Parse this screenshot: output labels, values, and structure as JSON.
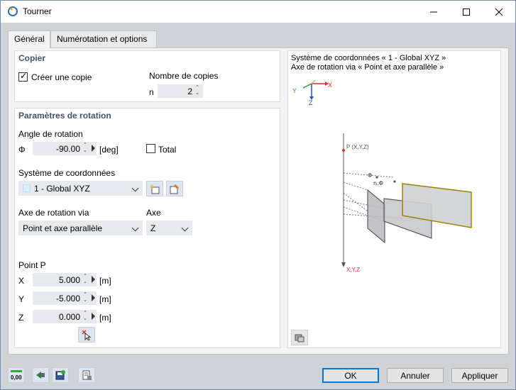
{
  "window": {
    "title": "Tourner",
    "app_icon": "rotate-tool-icon"
  },
  "tabs": [
    {
      "label": "Général",
      "active": true
    },
    {
      "label": "Numérotation et options",
      "active": false
    }
  ],
  "copy": {
    "title": "Copier",
    "create_copy_label": "Créer une copie",
    "create_copy_checked": true,
    "count_label": "Nombre de copies",
    "n_label": "n",
    "count_value": "2"
  },
  "rotation": {
    "title": "Paramètres de rotation",
    "angle_label": "Angle de rotation",
    "phi_label": "Φ",
    "angle_value": "-90.00",
    "angle_unit": "[deg]",
    "total_label": "Total",
    "total_checked": false,
    "coord_label": "Système de coordonnées",
    "coord_value": "1 - Global XYZ",
    "axis_via_label": "Axe de rotation via",
    "axis_via_value": "Point et axe parallèle",
    "axis_label": "Axe",
    "axis_value": "Z",
    "point_label": "Point P",
    "points": [
      {
        "label": "X",
        "value": "5.000",
        "unit": "[m]"
      },
      {
        "label": "Y",
        "value": "-5.000",
        "unit": "[m]"
      },
      {
        "label": "Z",
        "value": "0.000",
        "unit": "[m]"
      }
    ]
  },
  "preview": {
    "line1": "Système de coordonnées « 1 - Global XYZ »",
    "line2": "Axe de rotation via « Point et axe parallèle »",
    "axis_y": "Y",
    "axis_x": "X",
    "axis_z": "Z",
    "point_label": "P (X,Y,Z)",
    "phi_label": "Φ",
    "nphi_label": "n.Φ",
    "bottom_label": "X,Y,Z"
  },
  "footer": {
    "ok": "OK",
    "cancel": "Annuler",
    "apply": "Appliquer",
    "units_icon_label": "0,00"
  },
  "colors": {
    "accent": "#0078d7",
    "group_title": "#44546a",
    "axis_x": "#e03030",
    "axis_y": "#30a030",
    "axis_z": "#2050d0",
    "copy_outline": "#a08000"
  }
}
